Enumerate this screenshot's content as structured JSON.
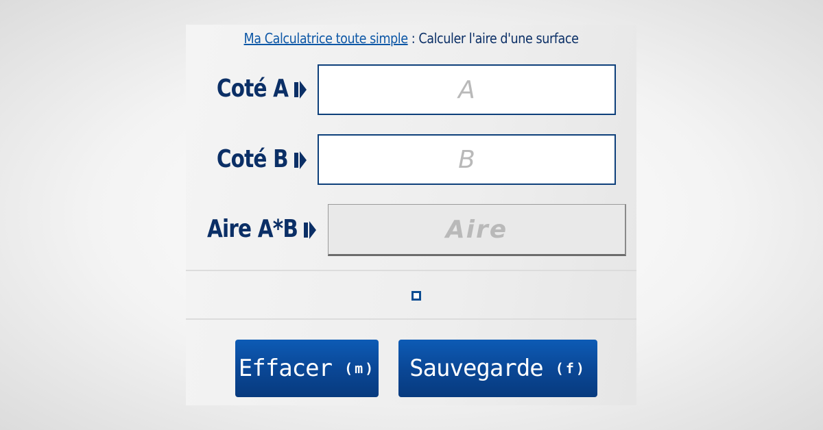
{
  "header": {
    "link_text": "Ma Calculatrice toute simple",
    "rest_text": " : Calculer l'aire d'une surface"
  },
  "fields": [
    {
      "label": "Coté A",
      "placeholder": "A",
      "value": ""
    },
    {
      "label": "Coté B",
      "placeholder": "B",
      "value": ""
    },
    {
      "label": "Aire A*B",
      "placeholder": "Aire",
      "value": ""
    }
  ],
  "buttons": {
    "clear_label": "Effacer",
    "clear_key": "(m)",
    "save_label": "Sauvegarde",
    "save_key": "(f)"
  },
  "colors": {
    "text_primary": "#0b2f66",
    "link": "#0d57a6",
    "button_bg": "#0a4694",
    "placeholder": "#b9b9b9"
  },
  "icons": {
    "label_arrow": "triangle-right-icon",
    "status": "square-indicator-icon"
  }
}
